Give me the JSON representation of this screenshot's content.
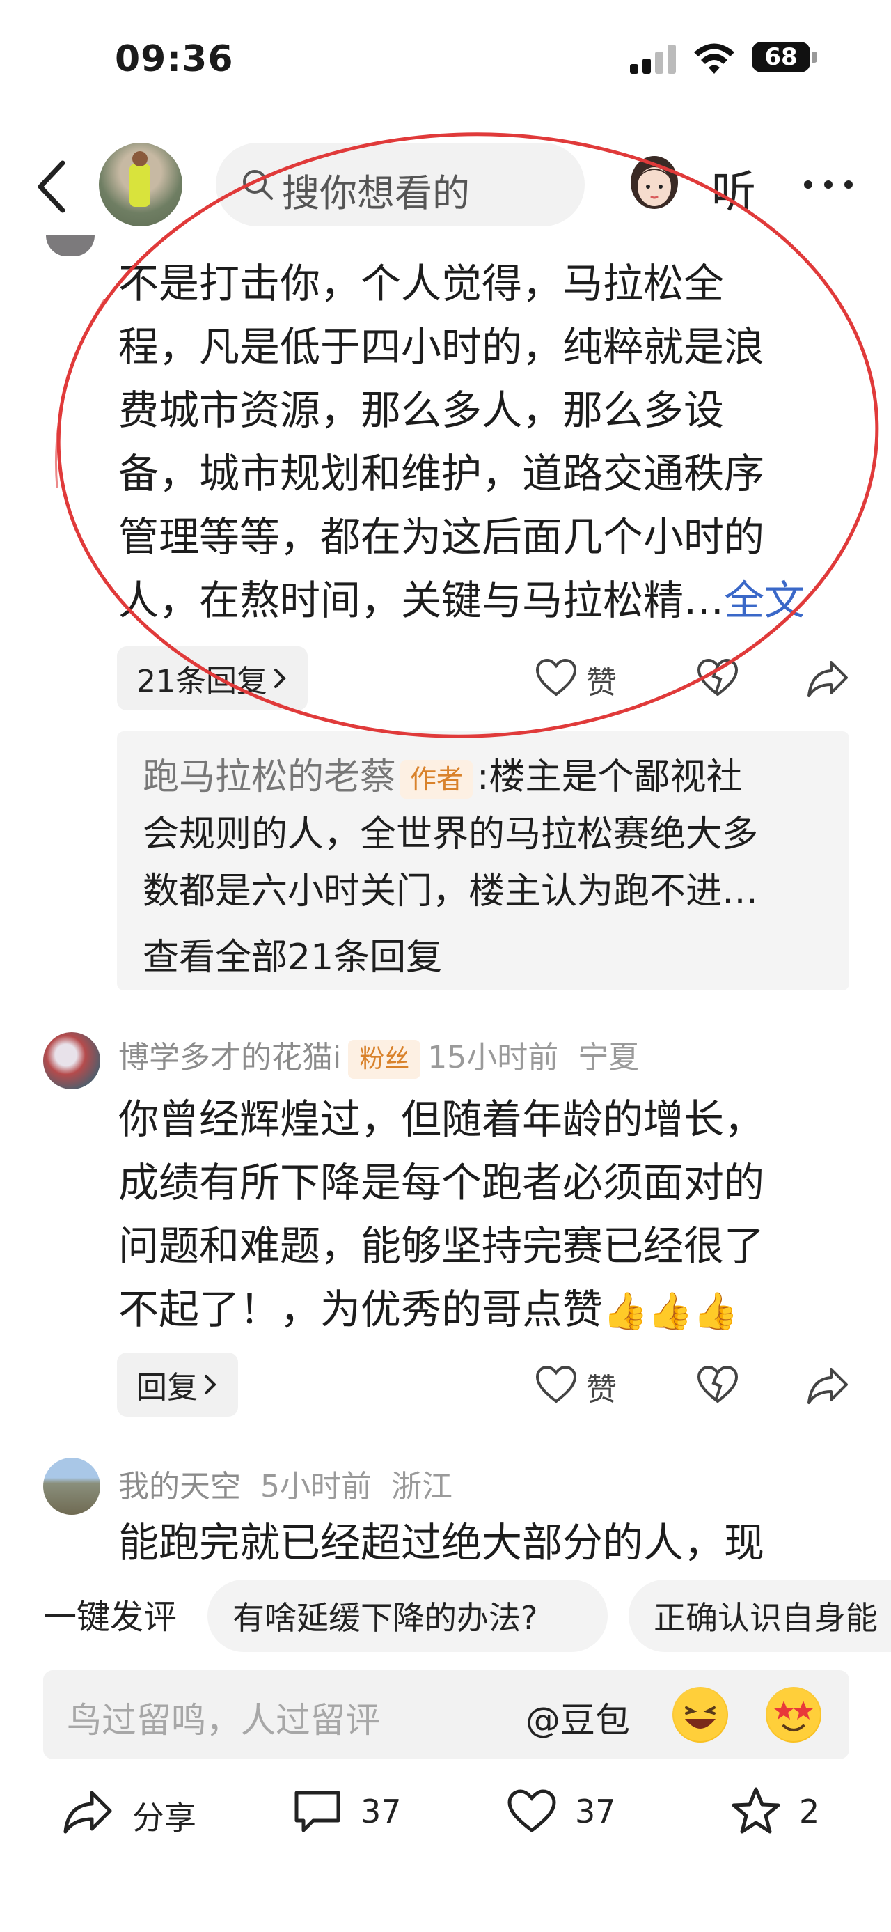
{
  "status_bar": {
    "time": "09:36",
    "battery": "68"
  },
  "nav": {
    "search_placeholder": "搜你想看的",
    "listen_label": "听"
  },
  "comment1": {
    "lines": [
      "不是打击你，个人觉得，马拉松全",
      "程，凡是低于四小时的，纯粹就是浪",
      "费城市资源，那么多人，那么多设",
      "备，城市规划和维护，道路交通秩序",
      "管理等等，都在为这后面几个小时的",
      "人，在熬时间，关键与马拉松精…"
    ],
    "full_text_link": "全文",
    "replies_button": "21条回复",
    "like_label": "赞"
  },
  "replies_box": {
    "author_name": "跑马拉松的老蔡",
    "author_tag": "作者",
    "line1_rest": ":楼主是个鄙视社",
    "line2": "会规则的人，全世界的马拉松赛绝大多",
    "line3": "数都是六小时关门，楼主认为跑不进…",
    "view_all": "查看全部21条回复"
  },
  "comment2": {
    "username": "博学多才的花猫i",
    "tag": "粉丝",
    "time": "15小时前",
    "location": "宁夏",
    "lines": [
      "你曾经辉煌过，但随着年龄的增长，",
      "成绩有所下降是每个跑者必须面对的",
      "问题和难题，能够坚持完赛已经很了",
      "不起了！，为优秀的哥点赞"
    ],
    "emojis": "👍👍👍",
    "reply_button": "回复",
    "like_label": "赞"
  },
  "comment3": {
    "username": "我的天空",
    "time": "5小时前",
    "location": "浙江",
    "line": "能跑完就已经超过绝大部分的人，现"
  },
  "quick_reply": {
    "label": "一键发评",
    "chips": [
      "有啥延缓下降的办法?",
      "正确认识自身能"
    ]
  },
  "input": {
    "placeholder": "鸟过留鸣，人过留评",
    "mention": "@豆包"
  },
  "bottom_bar": {
    "share_label": "分享",
    "comment_count": "37",
    "like_count": "37",
    "favorite_count": "2"
  },
  "colors": {
    "link": "#3a68c8",
    "tag_bg": "#fdf0e3",
    "tag_text": "#d9822b",
    "annotation": "#e03a3a"
  }
}
